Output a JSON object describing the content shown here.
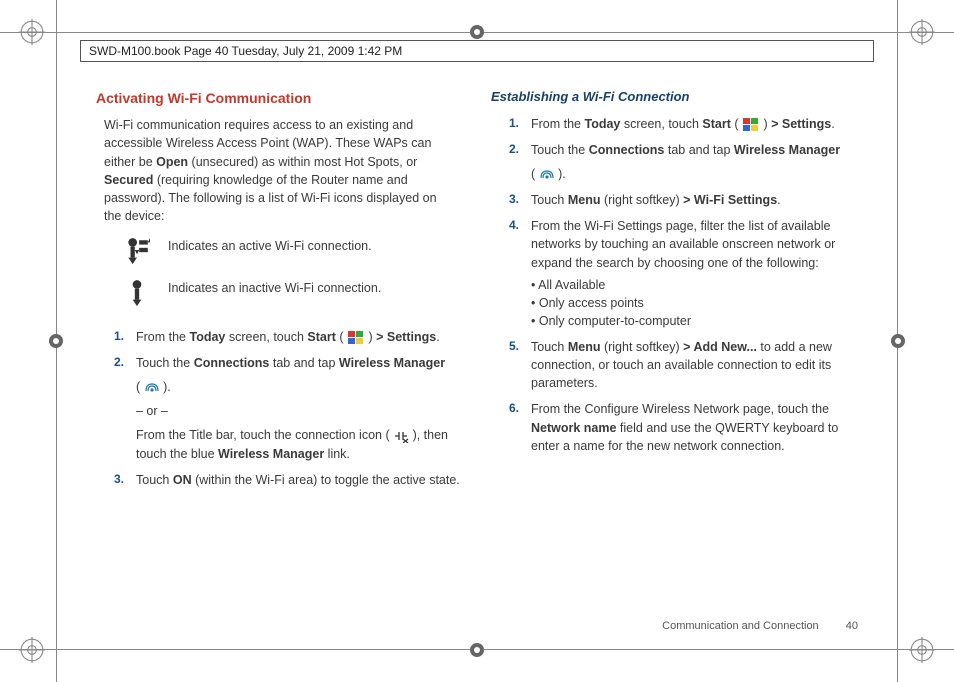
{
  "header": {
    "text": "SWD-M100.book  Page 40  Tuesday, July 21, 2009  1:42 PM"
  },
  "left": {
    "heading": "Activating Wi-Fi Communication",
    "intro_parts": {
      "p1": "Wi-Fi communication requires access to an existing and accessible Wireless Access Point (WAP). These WAPs can either be ",
      "b1": "Open",
      "p2": " (unsecured) as within most Hot Spots, or ",
      "b2": "Secured",
      "p3": " (requiring knowledge of the Router name and password). The following is a list of Wi-Fi icons displayed on the device:"
    },
    "icon1": "Indicates an active Wi-Fi connection.",
    "icon2": "Indicates an inactive Wi-Fi connection.",
    "steps": {
      "s1": {
        "num": "1.",
        "a": "From the ",
        "b1": "Today",
        "b": " screen, touch ",
        "b2": "Start",
        "c": " ( ",
        "d": " ) ",
        "b3": "> Settings",
        "e": "."
      },
      "s2": {
        "num": "2.",
        "a": "Touch the ",
        "b1": "Connections",
        "b": " tab and tap ",
        "b2": "Wireless Manager",
        "paren_open": "( ",
        "paren_close": " ).",
        "or": "– or –",
        "alt_a": "From the Title bar, touch the connection icon ( ",
        "alt_b": " ), then touch the blue ",
        "alt_bold": "Wireless Manager",
        "alt_c": " link."
      },
      "s3": {
        "num": "3.",
        "a": "Touch ",
        "b1": "ON",
        "b": " (within the Wi-Fi area) to toggle the active state."
      }
    }
  },
  "right": {
    "heading": "Establishing a Wi-Fi Connection",
    "steps": {
      "s1": {
        "num": "1.",
        "a": "From the ",
        "b1": "Today",
        "b": " screen, touch ",
        "b2": "Start",
        "c": " ( ",
        "d": " ) ",
        "b3": "> Settings",
        "e": "."
      },
      "s2": {
        "num": "2.",
        "a": "Touch the ",
        "b1": "Connections",
        "b": " tab and tap ",
        "b2": "Wireless Manager",
        "paren_open": "( ",
        "paren_close": " )."
      },
      "s3": {
        "num": "3.",
        "a": "Touch ",
        "b1": "Menu",
        "b": " (right softkey) ",
        "b2": "> Wi-Fi Settings",
        "c": "."
      },
      "s4": {
        "num": "4.",
        "text": "From the Wi-Fi Settings page, filter the list of available networks by touching an available onscreen network or expand the search by choosing one of the following:",
        "bullets": {
          "b1": "All Available",
          "b2": "Only access points",
          "b3": "Only computer-to-computer"
        }
      },
      "s5": {
        "num": "5.",
        "a": "Touch ",
        "b1": "Menu",
        "b": " (right softkey) ",
        "b2": "> Add New...",
        "c": " to add a new connection, or touch an available connection to edit its parameters."
      },
      "s6": {
        "num": "6.",
        "a": "From the Configure Wireless Network page, touch the ",
        "b1": "Network name",
        "b": " field and use the QWERTY keyboard to enter a name for the new network connection."
      }
    }
  },
  "footer": {
    "section": "Communication and Connection",
    "page": "40"
  }
}
